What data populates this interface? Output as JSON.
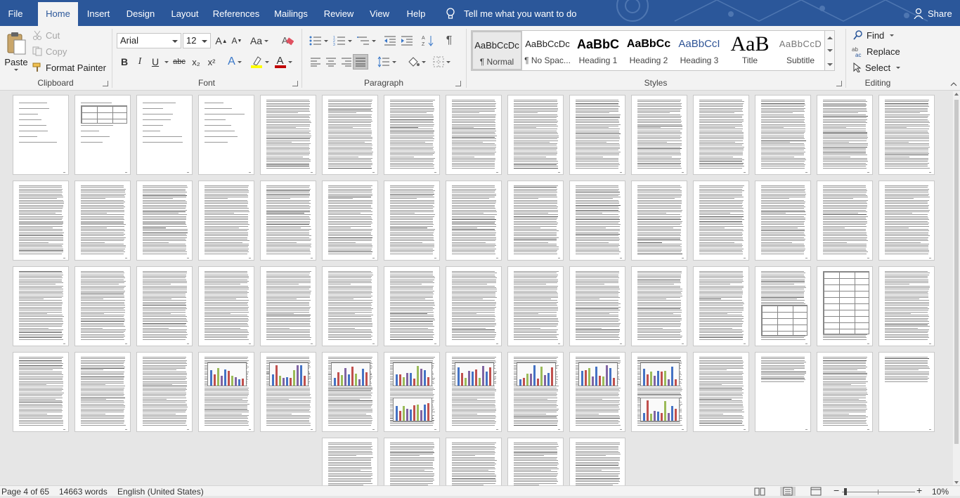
{
  "tabs": [
    "File",
    "Home",
    "Insert",
    "Design",
    "Layout",
    "References",
    "Mailings",
    "Review",
    "View",
    "Help"
  ],
  "active_tab": "Home",
  "tell_me": "Tell me what you want to do",
  "share": "Share",
  "clipboard": {
    "paste": "Paste",
    "cut": "Cut",
    "copy": "Copy",
    "format_painter": "Format Painter",
    "label": "Clipboard"
  },
  "font": {
    "name": "Arial",
    "size": "12",
    "label": "Font",
    "change_case": "Aa",
    "bold": "B",
    "italic": "I",
    "underline": "U",
    "strike": "abc",
    "subscript": "x₂",
    "superscript": "x²",
    "text_effects": "A",
    "font_color": "A",
    "grow": "A",
    "shrink": "A"
  },
  "paragraph": {
    "label": "Paragraph",
    "show_marks": "¶"
  },
  "styles": {
    "label": "Styles",
    "items": [
      {
        "preview": "AaBbCcDc",
        "name": "¶ Normal"
      },
      {
        "preview": "AaBbCcDc",
        "name": "¶ No Spac..."
      },
      {
        "preview": "AaBbC",
        "name": "Heading 1"
      },
      {
        "preview": "AaBbCc",
        "name": "Heading 2"
      },
      {
        "preview": "AaBbCcI",
        "name": "Heading 3"
      },
      {
        "preview": "AaB",
        "name": "Title"
      },
      {
        "preview": "AaBbCcD",
        "name": "Subtitle"
      }
    ]
  },
  "editing": {
    "label": "Editing",
    "find": "Find",
    "replace": "Replace",
    "select": "Select"
  },
  "status": {
    "page": "Page 4 of 65",
    "words": "14663 words",
    "language": "English (United States)",
    "zoom": "10%",
    "minus": "−",
    "plus": "+"
  },
  "colors": {
    "brand": "#2b579a",
    "ribbon": "#f3f3f3",
    "canvas": "#e6e6e6",
    "font_red": "#c00000",
    "highlight": "#ffff00"
  }
}
